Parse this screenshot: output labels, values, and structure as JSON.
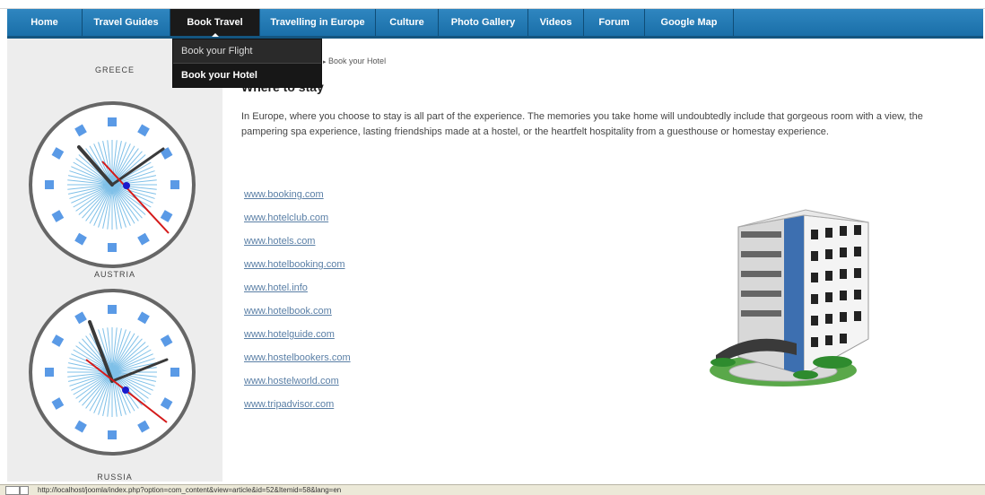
{
  "nav": {
    "items": [
      {
        "label": "Home"
      },
      {
        "label": "Travel Guides"
      },
      {
        "label": "Book Travel"
      },
      {
        "label": "Travelling in Europe"
      },
      {
        "label": "Culture"
      },
      {
        "label": "Photo Gallery"
      },
      {
        "label": "Videos"
      },
      {
        "label": "Forum"
      },
      {
        "label": "Google Map"
      }
    ],
    "active_index": 2
  },
  "dropdown": {
    "items": [
      "Book your Flight",
      "Book your Hotel"
    ],
    "selected_index": 1
  },
  "clocks": {
    "labels": [
      "GREECE",
      "AUSTRIA",
      "RUSSIA"
    ]
  },
  "breadcrumb": {
    "current": "Book your Hotel"
  },
  "content": {
    "title": "Where to stay",
    "intro": "In Europe, where you choose to stay is all part of the experience. The memories you take home will undoubtedly include that gorgeous room with a view, the pampering spa experience, lasting friendships made at a hostel, or the heartfelt hospitality from a guesthouse or homestay experience.",
    "links": [
      "www.booking.com",
      "www.hotelclub.com",
      "www.hotels.com",
      "www.hotelbooking.com",
      "www.hotel.info",
      "www.hotelbook.com",
      "www.hotelguide.com",
      "www.hostelbookers.com",
      "www.hostelworld.com",
      "www.tripadvisor.com"
    ]
  },
  "status_bar": {
    "url": "http://localhost/joomla/index.php?option=com_content&view=article&id=52&Itemid=58&lang=en"
  },
  "colors": {
    "nav_bg": "#1a6fa8",
    "clock_marker": "#5a9ae6",
    "second_hand": "#d41a1a",
    "link": "#5a7fa6"
  }
}
